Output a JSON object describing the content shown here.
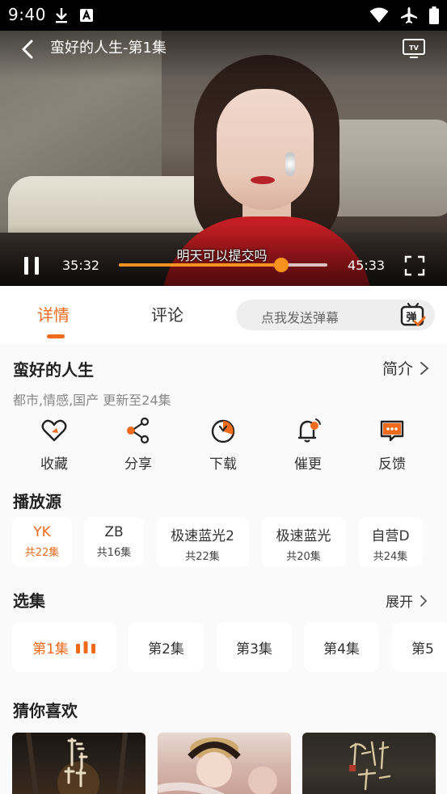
{
  "status_bar": {
    "time": "9:40",
    "left_icons": [
      "download-icon",
      "a-badge-icon"
    ],
    "right_icons": [
      "wifi-icon",
      "airplane-icon",
      "battery-icon"
    ]
  },
  "player": {
    "title": "蛮好的人生-第1集",
    "subtitle": "明天可以提交吗",
    "current_time": "35:32",
    "total_time": "45:33",
    "progress": 0.78,
    "accent_color": "#f7921e"
  },
  "tabs": {
    "details": "详情",
    "comments": "评论",
    "danmaku_placeholder": "点我发送弹幕",
    "danmaku_icon_char": "弹"
  },
  "show": {
    "title": "蛮好的人生",
    "intro_label": "简介",
    "meta": "都市,情感,国产 更新至24集"
  },
  "actions": [
    {
      "label": "收藏",
      "icon": "favorite-heart-icon"
    },
    {
      "label": "分享",
      "icon": "share-icon"
    },
    {
      "label": "下载",
      "icon": "download-icon"
    },
    {
      "label": "催更",
      "icon": "bell-icon"
    },
    {
      "label": "反馈",
      "icon": "feedback-icon"
    }
  ],
  "sources": {
    "title": "播放源",
    "items": [
      {
        "name": "YK",
        "count": "共22集",
        "active": true
      },
      {
        "name": "ZB",
        "count": "共16集",
        "active": false
      },
      {
        "name": "极速蓝光2",
        "count": "共22集",
        "active": false
      },
      {
        "name": "极速蓝光",
        "count": "共20集",
        "active": false
      },
      {
        "name": "自营D",
        "count": "共24集",
        "active": false
      }
    ]
  },
  "episodes": {
    "title": "选集",
    "expand_label": "展开",
    "items": [
      "第1集",
      "第2集",
      "第3集",
      "第4集",
      "第5"
    ]
  },
  "recommendations": {
    "title": "猜你喜欢",
    "posters": [
      {
        "icon": "poster-1"
      },
      {
        "icon": "poster-2"
      },
      {
        "icon": "poster-3"
      }
    ]
  },
  "colors": {
    "accent": "#f06a1b",
    "status_bar": "#000000"
  }
}
